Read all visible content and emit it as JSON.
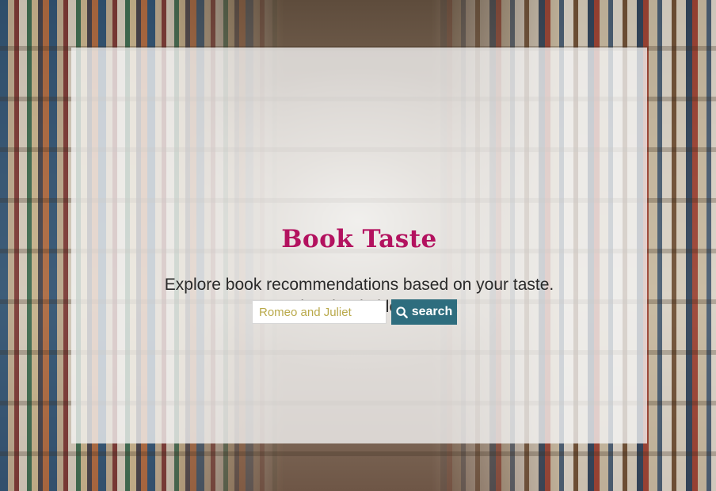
{
  "app": {
    "logo_text": "Book Taste",
    "tagline": "Explore book recommendations based on your taste. Type in a book title to start."
  },
  "search": {
    "placeholder": "Romeo and Juliet",
    "value": "",
    "button_label": "search",
    "button_icon": "search-icon"
  },
  "colors": {
    "brand": "#b3125f",
    "button": "#2e6d7e",
    "placeholder": "#b9a94a"
  }
}
